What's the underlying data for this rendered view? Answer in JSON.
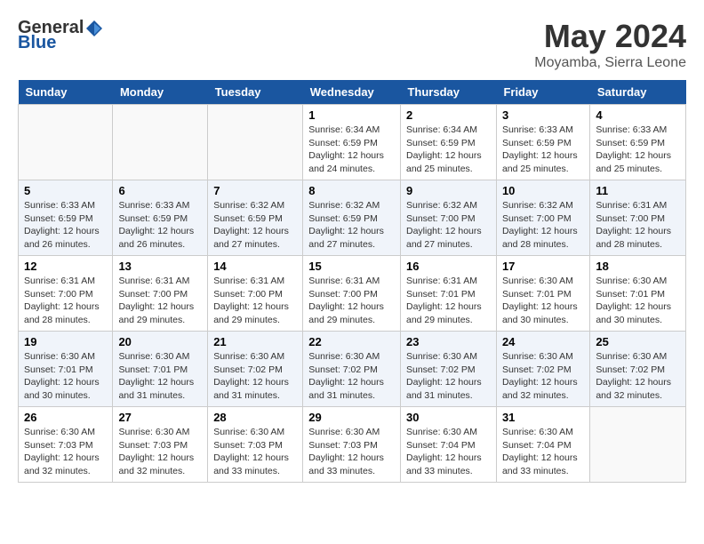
{
  "header": {
    "logo_general": "General",
    "logo_blue": "Blue",
    "month_title": "May 2024",
    "location": "Moyamba, Sierra Leone"
  },
  "weekdays": [
    "Sunday",
    "Monday",
    "Tuesday",
    "Wednesday",
    "Thursday",
    "Friday",
    "Saturday"
  ],
  "weeks": [
    [
      {
        "day": "",
        "info": ""
      },
      {
        "day": "",
        "info": ""
      },
      {
        "day": "",
        "info": ""
      },
      {
        "day": "1",
        "info": "Sunrise: 6:34 AM\nSunset: 6:59 PM\nDaylight: 12 hours\nand 24 minutes."
      },
      {
        "day": "2",
        "info": "Sunrise: 6:34 AM\nSunset: 6:59 PM\nDaylight: 12 hours\nand 25 minutes."
      },
      {
        "day": "3",
        "info": "Sunrise: 6:33 AM\nSunset: 6:59 PM\nDaylight: 12 hours\nand 25 minutes."
      },
      {
        "day": "4",
        "info": "Sunrise: 6:33 AM\nSunset: 6:59 PM\nDaylight: 12 hours\nand 25 minutes."
      }
    ],
    [
      {
        "day": "5",
        "info": "Sunrise: 6:33 AM\nSunset: 6:59 PM\nDaylight: 12 hours\nand 26 minutes."
      },
      {
        "day": "6",
        "info": "Sunrise: 6:33 AM\nSunset: 6:59 PM\nDaylight: 12 hours\nand 26 minutes."
      },
      {
        "day": "7",
        "info": "Sunrise: 6:32 AM\nSunset: 6:59 PM\nDaylight: 12 hours\nand 27 minutes."
      },
      {
        "day": "8",
        "info": "Sunrise: 6:32 AM\nSunset: 6:59 PM\nDaylight: 12 hours\nand 27 minutes."
      },
      {
        "day": "9",
        "info": "Sunrise: 6:32 AM\nSunset: 7:00 PM\nDaylight: 12 hours\nand 27 minutes."
      },
      {
        "day": "10",
        "info": "Sunrise: 6:32 AM\nSunset: 7:00 PM\nDaylight: 12 hours\nand 28 minutes."
      },
      {
        "day": "11",
        "info": "Sunrise: 6:31 AM\nSunset: 7:00 PM\nDaylight: 12 hours\nand 28 minutes."
      }
    ],
    [
      {
        "day": "12",
        "info": "Sunrise: 6:31 AM\nSunset: 7:00 PM\nDaylight: 12 hours\nand 28 minutes."
      },
      {
        "day": "13",
        "info": "Sunrise: 6:31 AM\nSunset: 7:00 PM\nDaylight: 12 hours\nand 29 minutes."
      },
      {
        "day": "14",
        "info": "Sunrise: 6:31 AM\nSunset: 7:00 PM\nDaylight: 12 hours\nand 29 minutes."
      },
      {
        "day": "15",
        "info": "Sunrise: 6:31 AM\nSunset: 7:00 PM\nDaylight: 12 hours\nand 29 minutes."
      },
      {
        "day": "16",
        "info": "Sunrise: 6:31 AM\nSunset: 7:01 PM\nDaylight: 12 hours\nand 29 minutes."
      },
      {
        "day": "17",
        "info": "Sunrise: 6:30 AM\nSunset: 7:01 PM\nDaylight: 12 hours\nand 30 minutes."
      },
      {
        "day": "18",
        "info": "Sunrise: 6:30 AM\nSunset: 7:01 PM\nDaylight: 12 hours\nand 30 minutes."
      }
    ],
    [
      {
        "day": "19",
        "info": "Sunrise: 6:30 AM\nSunset: 7:01 PM\nDaylight: 12 hours\nand 30 minutes."
      },
      {
        "day": "20",
        "info": "Sunrise: 6:30 AM\nSunset: 7:01 PM\nDaylight: 12 hours\nand 31 minutes."
      },
      {
        "day": "21",
        "info": "Sunrise: 6:30 AM\nSunset: 7:02 PM\nDaylight: 12 hours\nand 31 minutes."
      },
      {
        "day": "22",
        "info": "Sunrise: 6:30 AM\nSunset: 7:02 PM\nDaylight: 12 hours\nand 31 minutes."
      },
      {
        "day": "23",
        "info": "Sunrise: 6:30 AM\nSunset: 7:02 PM\nDaylight: 12 hours\nand 31 minutes."
      },
      {
        "day": "24",
        "info": "Sunrise: 6:30 AM\nSunset: 7:02 PM\nDaylight: 12 hours\nand 32 minutes."
      },
      {
        "day": "25",
        "info": "Sunrise: 6:30 AM\nSunset: 7:02 PM\nDaylight: 12 hours\nand 32 minutes."
      }
    ],
    [
      {
        "day": "26",
        "info": "Sunrise: 6:30 AM\nSunset: 7:03 PM\nDaylight: 12 hours\nand 32 minutes."
      },
      {
        "day": "27",
        "info": "Sunrise: 6:30 AM\nSunset: 7:03 PM\nDaylight: 12 hours\nand 32 minutes."
      },
      {
        "day": "28",
        "info": "Sunrise: 6:30 AM\nSunset: 7:03 PM\nDaylight: 12 hours\nand 33 minutes."
      },
      {
        "day": "29",
        "info": "Sunrise: 6:30 AM\nSunset: 7:03 PM\nDaylight: 12 hours\nand 33 minutes."
      },
      {
        "day": "30",
        "info": "Sunrise: 6:30 AM\nSunset: 7:04 PM\nDaylight: 12 hours\nand 33 minutes."
      },
      {
        "day": "31",
        "info": "Sunrise: 6:30 AM\nSunset: 7:04 PM\nDaylight: 12 hours\nand 33 minutes."
      },
      {
        "day": "",
        "info": ""
      }
    ]
  ]
}
